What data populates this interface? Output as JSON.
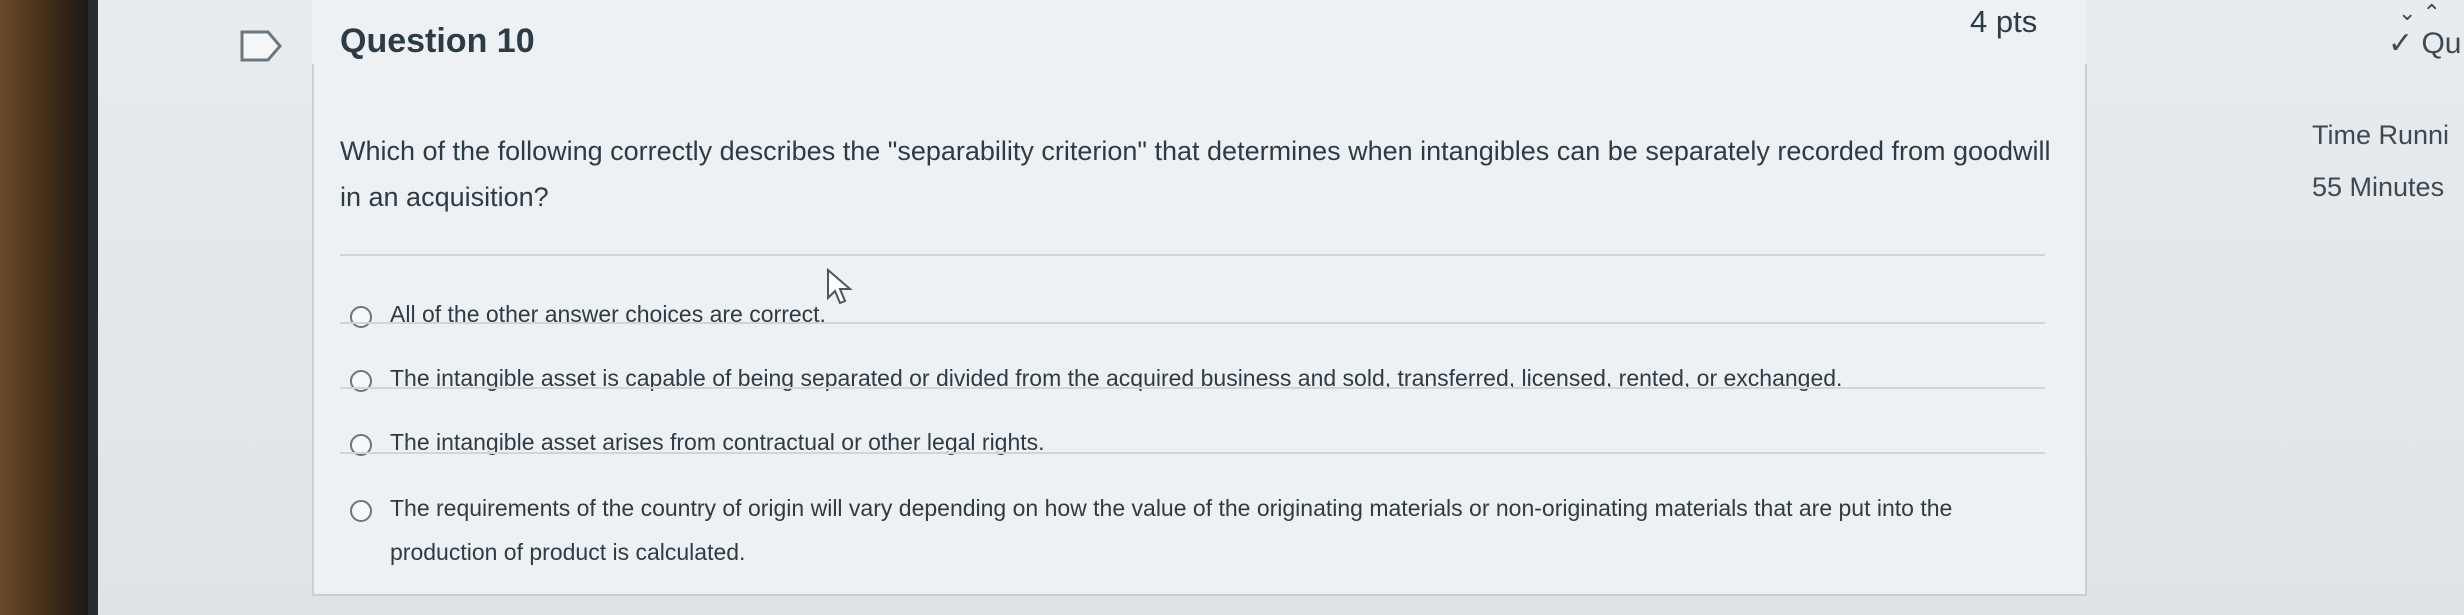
{
  "question": {
    "title": "Question 10",
    "points": "4 pts",
    "text": "Which of the following correctly describes the \"separability criterion\" that determines when intangibles can be separately recorded from goodwill in an acquisition?",
    "answers": [
      {
        "label": "All of the other answer choices are correct."
      },
      {
        "label": "The intangible asset is capable of being separated or divided from the acquired business and sold, transferred, licensed, rented, or exchanged."
      },
      {
        "label": "The intangible asset arises from contractual or other legal rights."
      },
      {
        "label": "The requirements of the country of origin will vary depending on how the value of the originating materials or non-originating materials that are put into the production of product is calculated."
      }
    ]
  },
  "side_panel": {
    "nav_item": "✓ Qu",
    "time_label": "Time Runni",
    "time_value": "55 Minutes"
  }
}
